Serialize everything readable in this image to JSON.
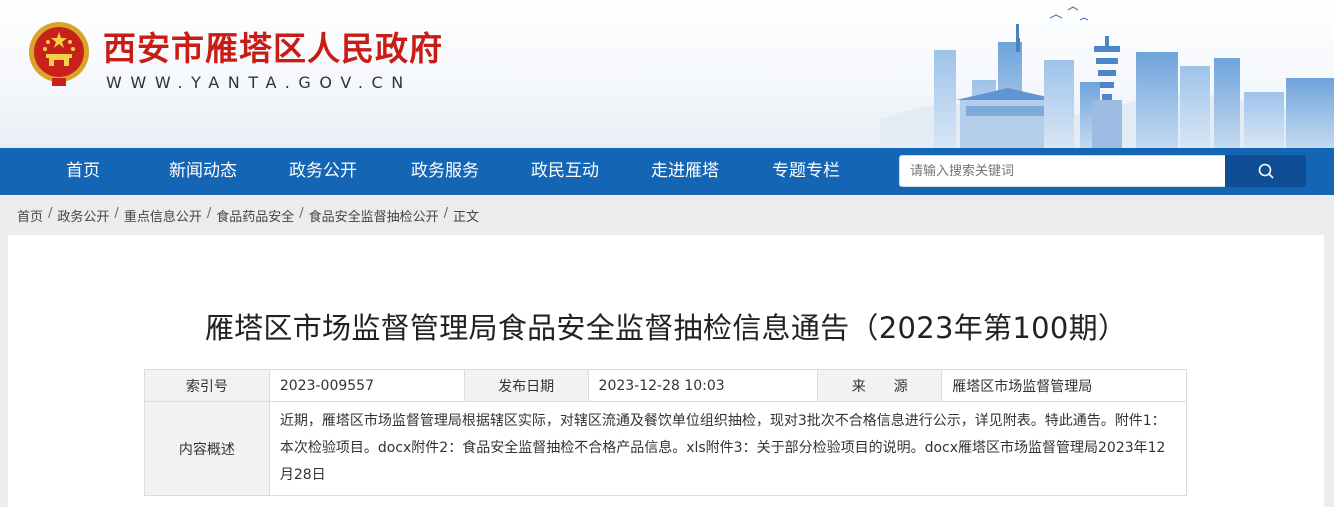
{
  "header": {
    "site_title": "西安市雁塔区人民政府",
    "site_url": "WWW.YANTA.GOV.CN",
    "brand_color": "#c81d16"
  },
  "nav": {
    "items": [
      "首页",
      "新闻动态",
      "政务公开",
      "政务服务",
      "政民互动",
      "走进雁塔",
      "专题专栏"
    ],
    "background": "#1565b5"
  },
  "search": {
    "placeholder": "请输入搜索关键词",
    "icon": "search-icon"
  },
  "breadcrumb": {
    "items": [
      "首页",
      "政务公开",
      "重点信息公开",
      "食品药品安全",
      "食品安全监督抽检公开"
    ],
    "current": "正文"
  },
  "article": {
    "title": "雁塔区市场监督管理局食品安全监督抽检信息通告（2023年第100期）",
    "meta": {
      "index_label": "索引号",
      "index_value": "2023-009557",
      "date_label": "发布日期",
      "date_value": "2023-12-28 10:03",
      "source_label": "来　　源",
      "source_value": "雁塔区市场监督管理局",
      "summary_label": "内容概述",
      "summary_value": "近期，雁塔区市场监督管理局根据辖区实际，对辖区流通及餐饮单位组织抽检，现对3批次不合格信息进行公示，详见附表。特此通告。附件1：本次检验项目。docx附件2：食品安全监督抽检不合格产品信息。xls附件3：关于部分检验项目的说明。docx雁塔区市场监督管理局2023年12月28日"
    }
  }
}
